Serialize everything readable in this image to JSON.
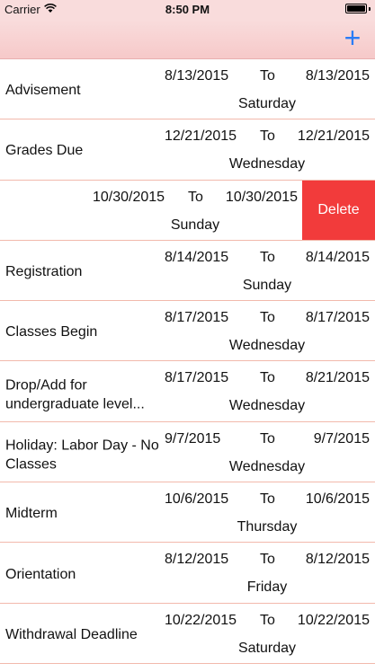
{
  "status_bar": {
    "carrier": "Carrier",
    "time": "8:50 PM",
    "wifi_icon": "wifi-icon",
    "battery_icon": "battery-icon"
  },
  "nav": {
    "add_icon": "plus-icon",
    "add_label": "+",
    "accent_color": "#2a7cf6",
    "bar_color": "#f9dcdc"
  },
  "list": {
    "to_label": "To",
    "delete_label": "Delete",
    "delete_color": "#f23b3b",
    "separator_color": "#f2b9ac",
    "rows": [
      {
        "name": "Advisement",
        "start": "8/13/2015",
        "end": "8/13/2015",
        "day": "Saturday"
      },
      {
        "name": "Grades Due",
        "start": "12/21/2015",
        "end": "12/21/2015",
        "day": "Wednesday"
      },
      {
        "name": "",
        "start": "10/30/2015",
        "end": "10/30/2015",
        "day": "Sunday",
        "swiped": true
      },
      {
        "name": "Registration",
        "start": "8/14/2015",
        "end": "8/14/2015",
        "day": "Sunday"
      },
      {
        "name": "Classes Begin",
        "start": "8/17/2015",
        "end": "8/17/2015",
        "day": "Wednesday"
      },
      {
        "name": "Drop/Add for undergraduate level...",
        "start": "8/17/2015",
        "end": "8/21/2015",
        "day": "Wednesday"
      },
      {
        "name": "Holiday: Labor Day - No Classes",
        "start": "9/7/2015",
        "end": "9/7/2015",
        "day": "Wednesday"
      },
      {
        "name": "Midterm",
        "start": "10/6/2015",
        "end": "10/6/2015",
        "day": "Thursday"
      },
      {
        "name": "Orientation",
        "start": "8/12/2015",
        "end": "8/12/2015",
        "day": "Friday"
      },
      {
        "name": "Withdrawal Deadline",
        "start": "10/22/2015",
        "end": "10/22/2015",
        "day": "Saturday"
      }
    ]
  }
}
